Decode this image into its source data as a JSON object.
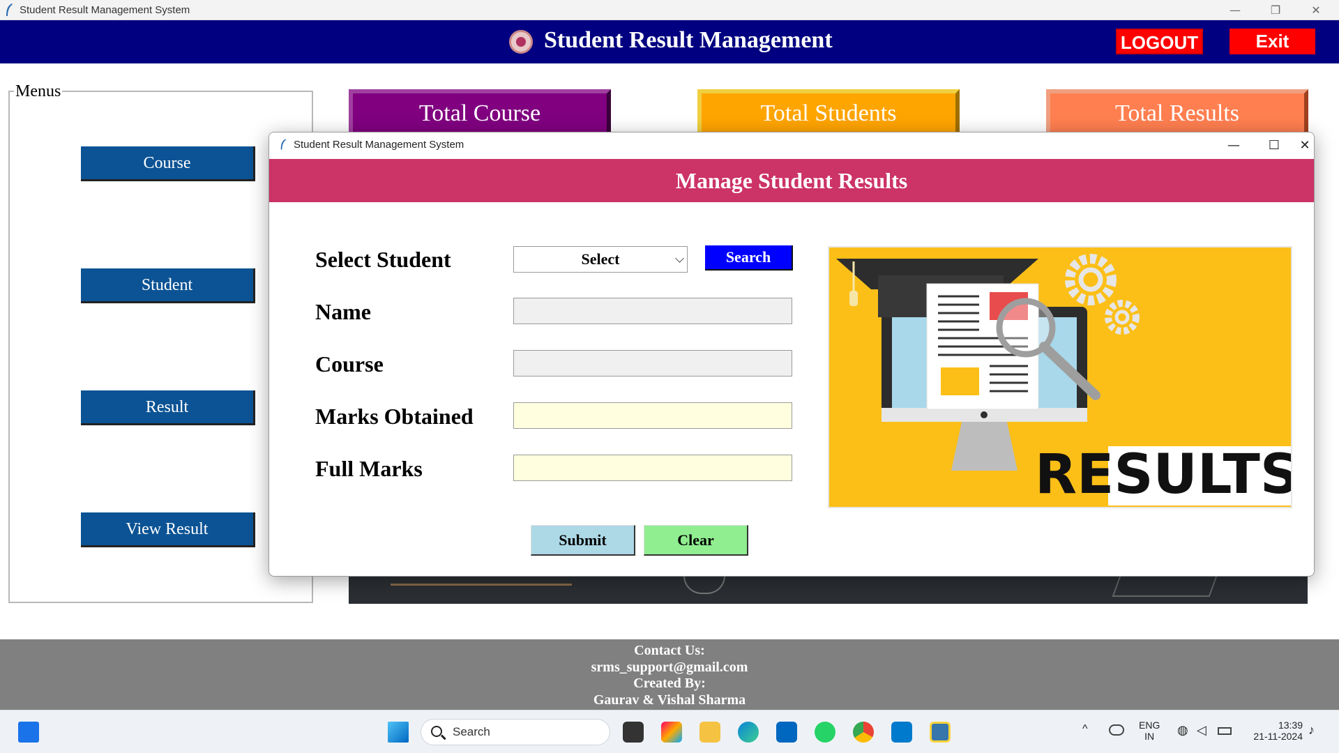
{
  "window": {
    "title": "Student Result Management System",
    "controls": {
      "minimize": "—",
      "restore": "❐",
      "close": "✕"
    }
  },
  "header": {
    "title": "Student Result Management",
    "logout_label": "LOGOUT",
    "exit_label": "Exit"
  },
  "menu": {
    "legend": "Menus",
    "items": [
      "Course",
      "Student",
      "Result",
      "View Result"
    ]
  },
  "stats": [
    {
      "label": "Total Course",
      "color": "#800080",
      "border": "#a040a0"
    },
    {
      "label": "Total Students",
      "color": "#ffa500",
      "border": "#f0c020"
    },
    {
      "label": "Total Results",
      "color": "#ff7f50",
      "border": "#d06040"
    }
  ],
  "footer": {
    "line1": "Contact Us:",
    "line2": "srms_support@gmail.com",
    "line3": "Created By:",
    "line4": "Gaurav & Vishal Sharma"
  },
  "dialog": {
    "title": "Student Result Management System",
    "header": "Manage Student Results",
    "labels": {
      "select_student": "Select Student",
      "name": "Name",
      "course": "Course",
      "marks_obtained": "Marks Obtained",
      "full_marks": "Full Marks"
    },
    "select_value": "Select",
    "search_label": "Search",
    "submit_label": "Submit",
    "clear_label": "Clear",
    "fields": {
      "name": "",
      "course": "",
      "marks_obtained": "",
      "full_marks": ""
    },
    "illustration_text": "RESULTS"
  },
  "taskbar": {
    "search_label": "Search",
    "lang_line1": "ENG",
    "lang_line2": "IN",
    "time": "13:39",
    "date": "21-11-2024"
  },
  "colors": {
    "header_bg": "#000080",
    "dialog_header_bg": "#cc3366",
    "menu_button_bg": "#0b5394",
    "search_button_bg": "#0000ff",
    "submit_bg": "#add8e6",
    "clear_bg": "#90ee90",
    "logout_bg": "#ff0000",
    "footer_bg": "#808080",
    "illustration_bg": "#fcbf17"
  }
}
